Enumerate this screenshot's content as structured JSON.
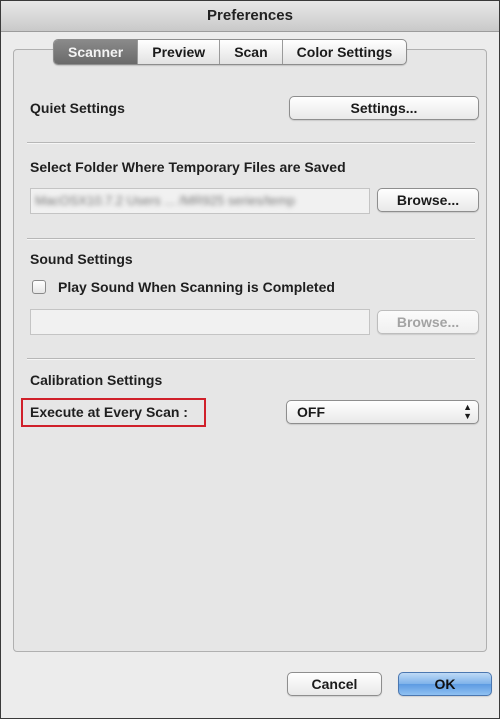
{
  "window": {
    "title": "Preferences"
  },
  "tabs": [
    {
      "label": "Scanner",
      "active": true
    },
    {
      "label": "Preview",
      "active": false
    },
    {
      "label": "Scan",
      "active": false
    },
    {
      "label": "Color Settings",
      "active": false
    }
  ],
  "quiet": {
    "label": "Quiet Settings",
    "button": "Settings..."
  },
  "temp_folder": {
    "label": "Select Folder Where Temporary Files are Saved",
    "path": "MacOSX10.7.2 Users ... /MR925 series/temp",
    "browse": "Browse..."
  },
  "sound": {
    "label": "Sound Settings",
    "checkbox_label": "Play Sound When Scanning is Completed",
    "checked": false,
    "path": "",
    "browse": "Browse..."
  },
  "calibration": {
    "label": "Calibration Settings",
    "execute_label": "Execute at Every Scan :",
    "execute_value": "OFF",
    "highlight_color": "#d0202a"
  },
  "footer": {
    "cancel": "Cancel",
    "ok": "OK"
  }
}
